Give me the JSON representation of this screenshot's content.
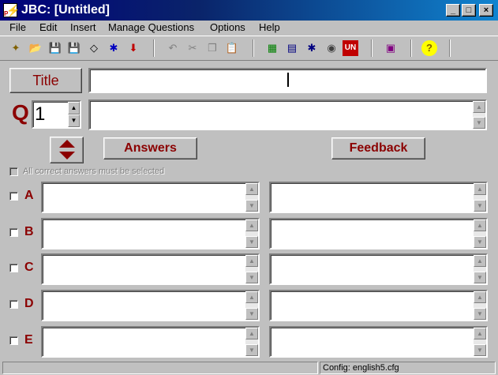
{
  "window": {
    "title": "JBC: [Untitled]",
    "controls": {
      "minimize": "_",
      "maximize": "□",
      "close": "×"
    }
  },
  "menu": [
    "File",
    "Edit",
    "Insert",
    "Manage Questions",
    "Options",
    "Help"
  ],
  "toolbar": {
    "buttons": [
      {
        "name": "new-icon",
        "glyph": "✦"
      },
      {
        "name": "open-icon",
        "glyph": "📂"
      },
      {
        "name": "save-icon",
        "glyph": "💾"
      },
      {
        "name": "save-as-icon",
        "glyph": "💾"
      },
      {
        "name": "eraser-icon",
        "glyph": "◇"
      },
      {
        "name": "web-icon",
        "glyph": "✱"
      },
      {
        "name": "down-arrow-icon",
        "glyph": "⬇"
      },
      {
        "name": "undo-icon",
        "glyph": "↶"
      },
      {
        "name": "cut-icon",
        "glyph": "✂"
      },
      {
        "name": "copy-icon",
        "glyph": "❐"
      },
      {
        "name": "paste-icon",
        "glyph": "📋"
      },
      {
        "name": "export-web-icon",
        "glyph": "▦"
      },
      {
        "name": "export-page-icon",
        "glyph": "▤"
      },
      {
        "name": "export-hot-icon",
        "glyph": "✱"
      },
      {
        "name": "export-cd-icon",
        "glyph": "◉"
      },
      {
        "name": "unicode-icon",
        "glyph": "UN"
      },
      {
        "name": "config-icon",
        "glyph": "▣"
      },
      {
        "name": "help-icon",
        "glyph": "?"
      }
    ]
  },
  "form": {
    "title_button": "Title",
    "title_value": "",
    "q_label": "Q",
    "question_number": "1",
    "question_text": "",
    "answers_button": "Answers",
    "feedback_button": "Feedback",
    "all_correct_label": "All correct answers must be selected",
    "answers": [
      {
        "letter": "A",
        "text": "",
        "feedback": ""
      },
      {
        "letter": "B",
        "text": "",
        "feedback": ""
      },
      {
        "letter": "C",
        "text": "",
        "feedback": ""
      },
      {
        "letter": "D",
        "text": "",
        "feedback": ""
      },
      {
        "letter": "E",
        "text": "",
        "feedback": ""
      }
    ]
  },
  "status": {
    "left": "",
    "config": "Config: english5.cfg"
  },
  "colors": {
    "accent": "#8b0000",
    "titlebar": "#0a246a",
    "face": "#c0c0c0"
  }
}
